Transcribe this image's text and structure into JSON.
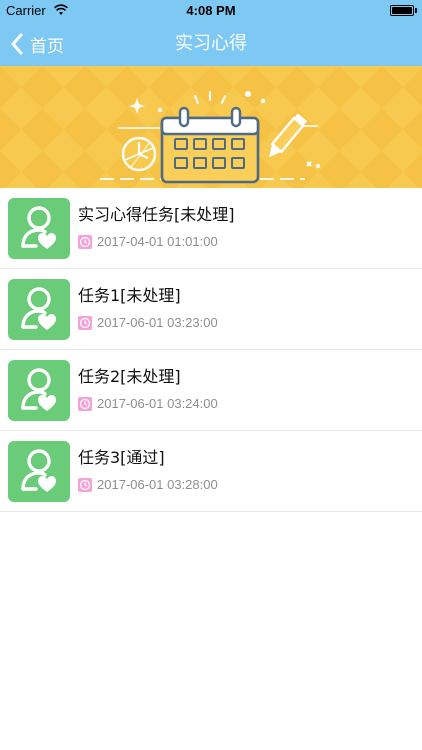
{
  "status_bar": {
    "carrier": "Carrier",
    "time": "4:08 PM"
  },
  "nav": {
    "back_label": "首页",
    "title": "实习心得"
  },
  "colors": {
    "nav_background": "#7ec8f4",
    "banner_background": "#f7c94f",
    "avatar_background": "#6acb78",
    "clock_icon_background": "#f3a3d6"
  },
  "items": [
    {
      "title": "实习心得任务[未处理]",
      "time": "2017-04-01 01:01:00",
      "icon": "user-heart-icon"
    },
    {
      "title": "任务1[未处理]",
      "time": "2017-06-01 03:23:00",
      "icon": "user-heart-icon"
    },
    {
      "title": "任务2[未处理]",
      "time": "2017-06-01 03:24:00",
      "icon": "user-heart-icon"
    },
    {
      "title": "任务3[通过]",
      "time": "2017-06-01 03:28:00",
      "icon": "user-heart-icon"
    }
  ]
}
